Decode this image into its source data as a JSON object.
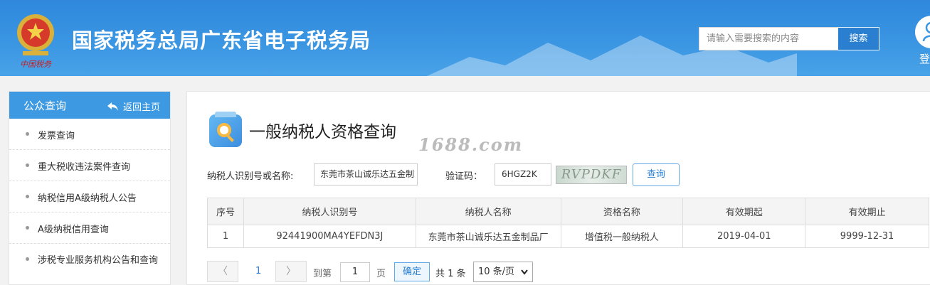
{
  "header": {
    "site_title": "国家税务总局广东省电子税务局",
    "search_placeholder": "请输入需要搜索的内容",
    "search_button": "搜索",
    "login_label": "登",
    "emblem_text": "中国税务"
  },
  "sidebar": {
    "title": "公众查询",
    "back_label": "返回主页",
    "items": [
      {
        "label": "发票查询"
      },
      {
        "label": "重大税收违法案件查询"
      },
      {
        "label": "纳税信用A级纳税人公告"
      },
      {
        "label": "A级纳税信用查询"
      },
      {
        "label": "涉税专业服务机构公告和查询"
      }
    ]
  },
  "main": {
    "page_title": "一般纳税人资格查询",
    "watermark": "1688.com",
    "form": {
      "taxpayer_label": "纳税人识别号或名称:",
      "taxpayer_value": "东莞市茶山诚乐达五金制",
      "captcha_label": "验证码：",
      "captcha_value": "6HGZ2K",
      "captcha_image_text": "RVPDKF",
      "query_button": "查询"
    },
    "table": {
      "headers": [
        "序号",
        "纳税人识别号",
        "纳税人名称",
        "资格名称",
        "有效期起",
        "有效期止"
      ],
      "rows": [
        [
          "1",
          "92441900MA4YEFDN3J",
          "东莞市茶山诚乐达五金制品厂",
          "增值税一般纳税人",
          "2019-04-01",
          "9999-12-31"
        ]
      ]
    },
    "pagination": {
      "prev": "〈",
      "current_page": "1",
      "next": "〉",
      "goto_label": "到第",
      "goto_value": "1",
      "page_label": "页",
      "confirm": "确定",
      "total": "共 1 条",
      "page_size": "10 条/页"
    }
  },
  "colors": {
    "header_blue": "#3a95e2",
    "sidebar_header": "#3d9ae2",
    "accent": "#2b80d4"
  }
}
